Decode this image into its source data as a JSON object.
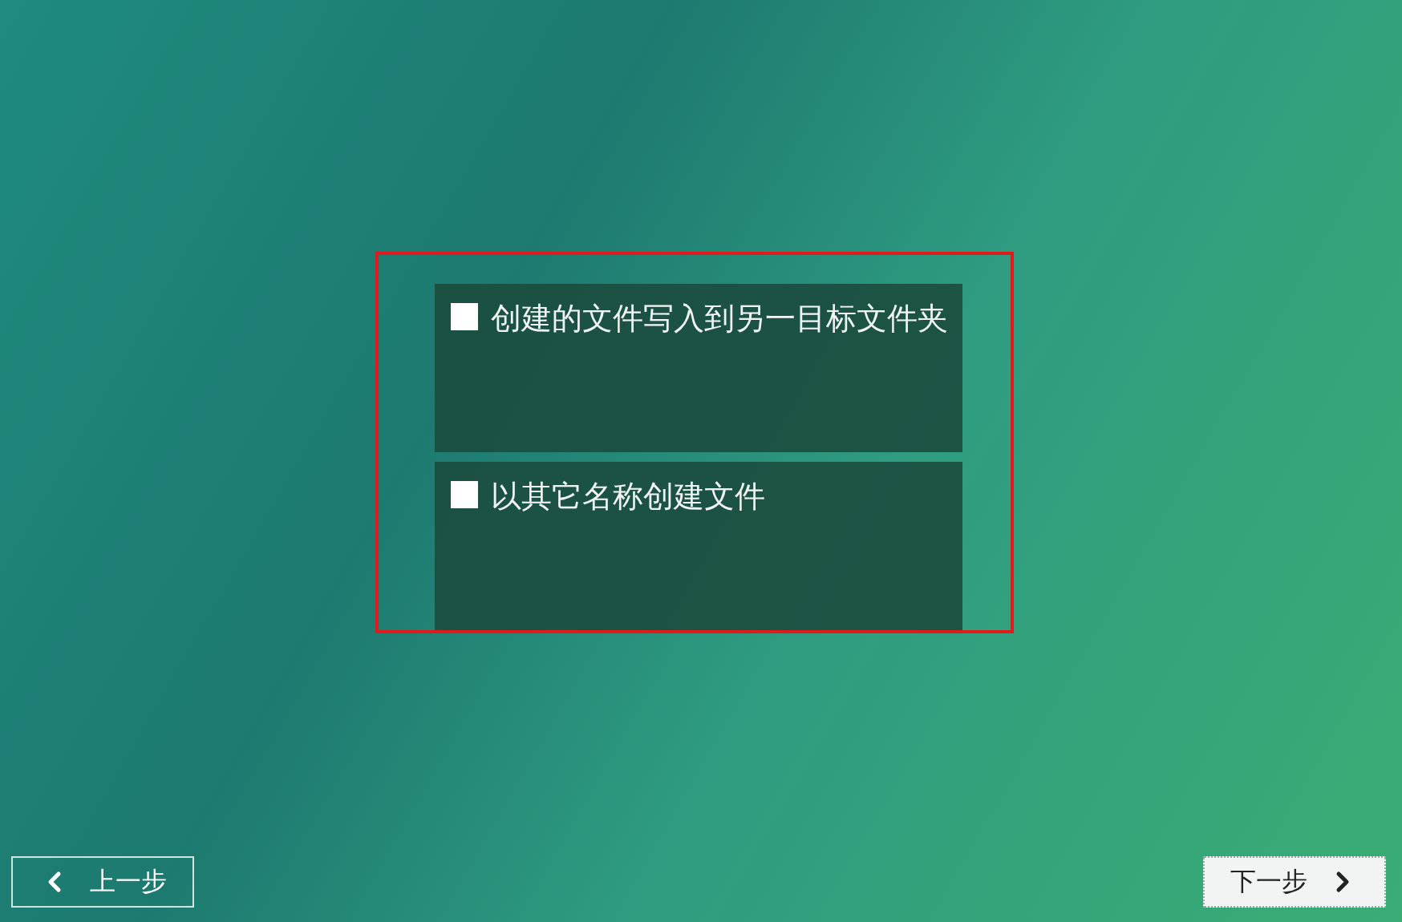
{
  "options": [
    {
      "label": "创建的文件写入到另一目标文件夹",
      "checked": false
    },
    {
      "label": "以其它名称创建文件",
      "checked": false
    }
  ],
  "nav_buttons": [
    {
      "kind": "back",
      "label": "上一步",
      "focused": false
    },
    {
      "kind": "next",
      "label": "下一步",
      "focused": true
    }
  ]
}
